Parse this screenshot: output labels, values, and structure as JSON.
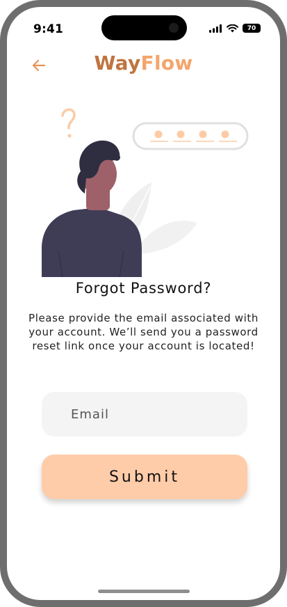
{
  "status_bar": {
    "time": "9:41",
    "battery": "70"
  },
  "header": {
    "logo_part1": "Way",
    "logo_part2": "Flow"
  },
  "content": {
    "title": "Forgot Password?",
    "description": "Please provide the email associated with your account. We’ll send you a password reset link once your account is located!"
  },
  "form": {
    "email_placeholder": "Email",
    "email_value": "",
    "submit_label": "Submit"
  },
  "colors": {
    "accent": "#c07440",
    "accent_light": "#f4a56c",
    "button": "#ffcca9",
    "field": "#f4f4f4",
    "figure": "#3f3d56",
    "skin": "#9e616a"
  },
  "icons": [
    "back-arrow-icon",
    "signal-icon",
    "wifi-icon",
    "battery-icon"
  ]
}
